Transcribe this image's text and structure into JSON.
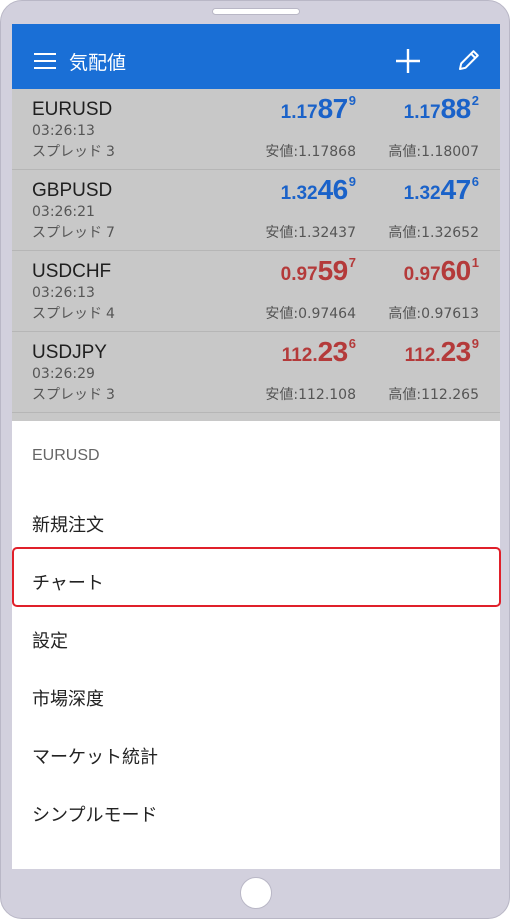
{
  "appbar": {
    "title": "気配値",
    "menu_icon": "hamburger-menu-icon",
    "add_icon": "plus-icon",
    "edit_icon": "pencil-icon",
    "color": "#1a6fd6"
  },
  "quotes": [
    {
      "symbol": "EURUSD",
      "time": "03:26:13",
      "spread_label": "スプレッド",
      "spread": "3",
      "bid_small": "1.17",
      "bid_big": "87",
      "bid_sup": "9",
      "ask_small": "1.17",
      "ask_big": "88",
      "ask_sup": "2",
      "low_label": "安値:",
      "low": "1.17868",
      "high_label": "高値:",
      "high": "1.18007",
      "color": "#1a62c9"
    },
    {
      "symbol": "GBPUSD",
      "time": "03:26:21",
      "spread_label": "スプレッド",
      "spread": "7",
      "bid_small": "1.32",
      "bid_big": "46",
      "bid_sup": "9",
      "ask_small": "1.32",
      "ask_big": "47",
      "ask_sup": "6",
      "low_label": "安値:",
      "low": "1.32437",
      "high_label": "高値:",
      "high": "1.32652",
      "color": "#1a62c9"
    },
    {
      "symbol": "USDCHF",
      "time": "03:26:13",
      "spread_label": "スプレッド",
      "spread": "4",
      "bid_small": "0.97",
      "bid_big": "59",
      "bid_sup": "7",
      "ask_small": "0.97",
      "ask_big": "60",
      "ask_sup": "1",
      "low_label": "安値:",
      "low": "0.97464",
      "high_label": "高値:",
      "high": "0.97613",
      "color": "#b43a3a"
    },
    {
      "symbol": "USDJPY",
      "time": "03:26:29",
      "spread_label": "スプレッド",
      "spread": "3",
      "bid_small": "112.",
      "bid_big": "23",
      "bid_sup": "6",
      "ask_small": "112.",
      "ask_big": "23",
      "ask_sup": "9",
      "low_label": "安値:",
      "low": "112.108",
      "high_label": "高値:",
      "high": "112.265",
      "color": "#b43a3a"
    }
  ],
  "context_menu": {
    "header": "EURUSD",
    "items": [
      "新規注文",
      "チャート",
      "設定",
      "市場深度",
      "マーケット統計",
      "シンプルモード"
    ],
    "highlighted_item": "チャート",
    "highlight_color": "#e0202a"
  }
}
